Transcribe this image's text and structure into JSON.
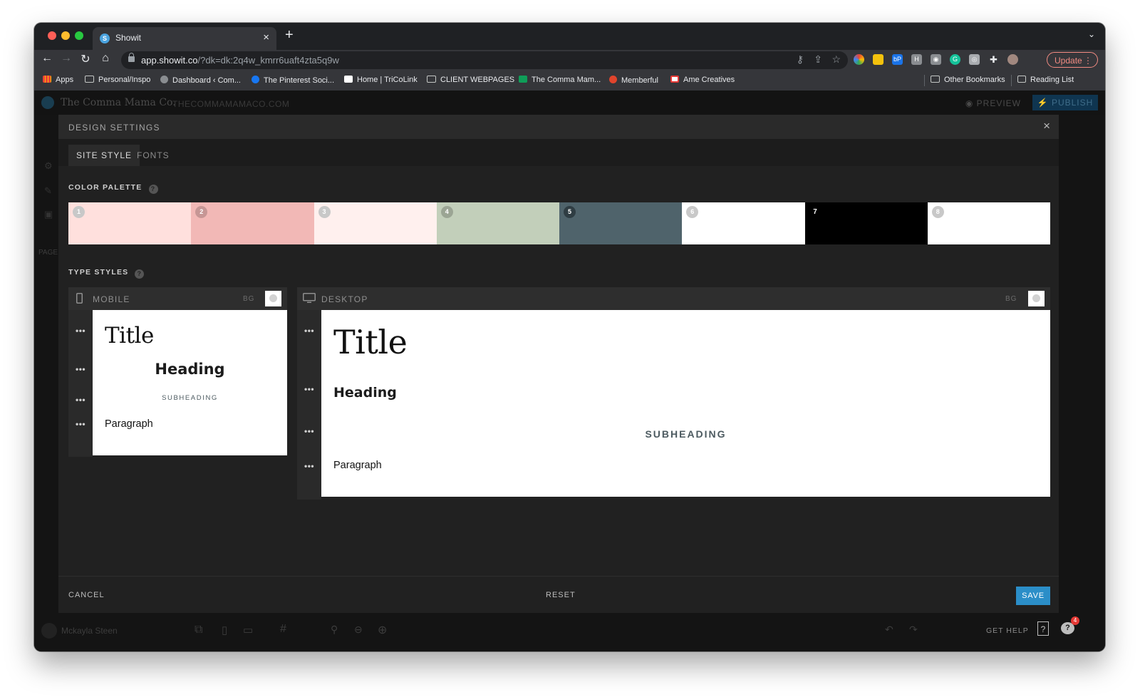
{
  "browser": {
    "tab_title": "Showit",
    "url_host": "app.showit.co",
    "url_path": "/?dk=dk:2q4w_kmrr6uaft4zta5q9w",
    "update_label": "Update",
    "bookmarks": [
      "Apps",
      "Personal/Inspo",
      "Dashboard ‹ Com...",
      "The Pinterest Soci...",
      "Home | TriCoLink",
      "CLIENT WEBPAGES",
      "The Comma Mam...",
      "Memberful",
      "Ame Creatives"
    ],
    "other_bookmarks": "Other Bookmarks",
    "reading_list": "Reading List"
  },
  "app": {
    "site_name": "The Comma Mama Co.",
    "site_domain": "THECOMMAMAMACO.COM",
    "preview_label": "PREVIEW",
    "publish_label": "PUBLISH",
    "user_name": "Mckayla Steen",
    "get_help": "GET HELP",
    "left_label": "PAGE",
    "notification_count": "4"
  },
  "modal": {
    "title": "DESIGN SETTINGS",
    "tabs": [
      "SITE STYLE",
      "FONTS"
    ],
    "palette_label": "COLOR PALETTE",
    "palette": [
      {
        "num": "1",
        "color": "#ffe0dd"
      },
      {
        "num": "2",
        "color": "#f2b8b6"
      },
      {
        "num": "3",
        "color": "#fff0ee"
      },
      {
        "num": "4",
        "color": "#c2cfba"
      },
      {
        "num": "5",
        "color": "#4f636b"
      },
      {
        "num": "6",
        "color": "#ffffff"
      },
      {
        "num": "7",
        "color": "#000000"
      },
      {
        "num": "8",
        "color": "#ffffff"
      }
    ],
    "type_styles_label": "TYPE STYLES",
    "mobile": {
      "label": "MOBILE",
      "bg_label": "BG",
      "title": "Title",
      "heading": "Heading",
      "subheading": "SUBHEADING",
      "paragraph": "Paragraph"
    },
    "desktop": {
      "label": "DESKTOP",
      "bg_label": "BG",
      "title": "Title",
      "heading": "Heading",
      "subheading": "SUBHEADING",
      "paragraph": "Paragraph"
    },
    "cancel_label": "CANCEL",
    "reset_label": "RESET",
    "save_label": "SAVE"
  }
}
